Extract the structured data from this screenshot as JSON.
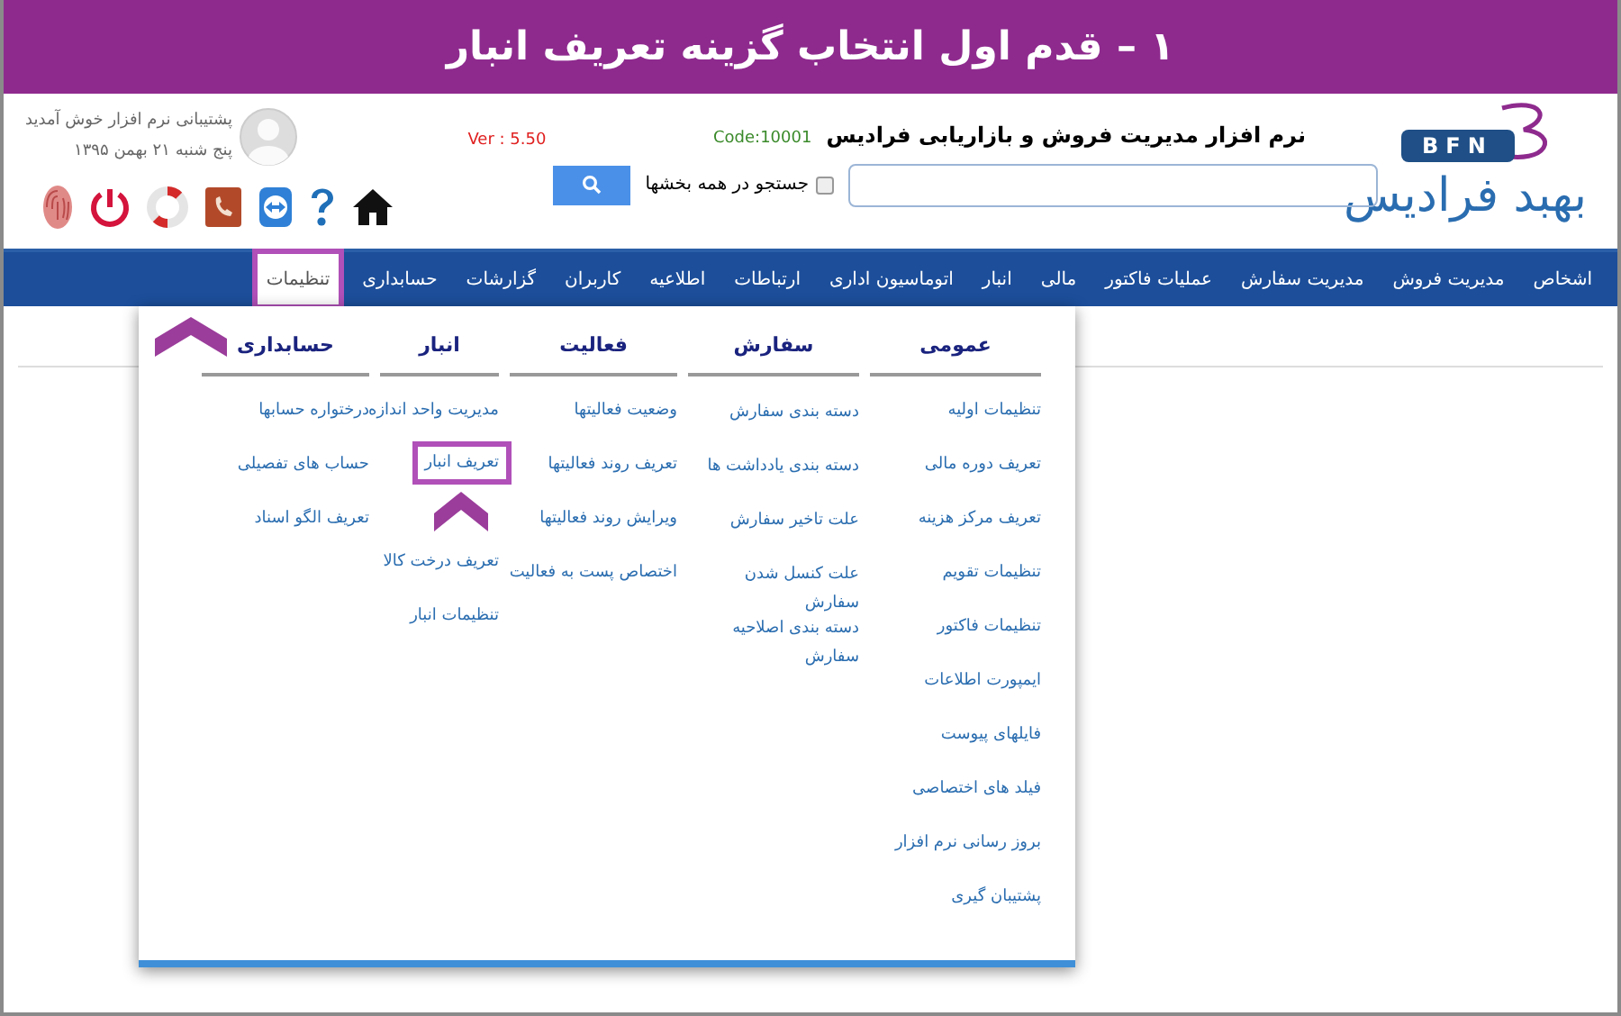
{
  "banner": {
    "title": "١ – قدم اول انتخاب گزینه تعریف انبار"
  },
  "header": {
    "logo_mark": "BFN",
    "logo_name": "بهبد فرادیس",
    "app_title": "نرم افزار مدیریت فروش و بازاریابی فرادیس",
    "code": "Code:10001",
    "version": "Ver : 5.50",
    "search_all": {
      "label": "جستجو در همه بخشها",
      "checked": false
    },
    "user": {
      "greeting": "پشتیبانی نرم افزار خوش آمدید",
      "date": "پنج شنبه ۲۱ بهمن ۱۳۹۵"
    }
  },
  "nav": [
    {
      "label": "اشخاص",
      "selected": false
    },
    {
      "label": "مدیریت فروش",
      "selected": false
    },
    {
      "label": "مدیریت سفارش",
      "selected": false
    },
    {
      "label": "عملیات فاکتور",
      "selected": false
    },
    {
      "label": "مالی",
      "selected": false
    },
    {
      "label": "انبار",
      "selected": false
    },
    {
      "label": "اتوماسیون اداری",
      "selected": false
    },
    {
      "label": "ارتباطات",
      "selected": false
    },
    {
      "label": "اطلاعیه",
      "selected": false
    },
    {
      "label": "کاربران",
      "selected": false
    },
    {
      "label": "گزارشات",
      "selected": false
    },
    {
      "label": "حسابداری",
      "selected": false
    },
    {
      "label": "تنظیمات",
      "selected": true
    }
  ],
  "menu": [
    {
      "title": "عمومی",
      "items": [
        {
          "label": "تنظیمات اولیه",
          "highlighted": false
        },
        {
          "label": "تعریف دوره مالی",
          "highlighted": false
        },
        {
          "label": "تعریف مرکز هزینه",
          "highlighted": false
        },
        {
          "label": "تنظیمات تقویم",
          "highlighted": false
        },
        {
          "label": "تنظیمات فاکتور",
          "highlighted": false
        },
        {
          "label": "ایمپورت اطلاعات",
          "highlighted": false
        },
        {
          "label": "فایلهای پیوست",
          "highlighted": false
        },
        {
          "label": "فیلد های اختصاصی",
          "highlighted": false
        },
        {
          "label": "بروز رسانی نرم افزار",
          "highlighted": false
        },
        {
          "label": "پشتیبان گیری",
          "highlighted": false
        }
      ]
    },
    {
      "title": "سفارش",
      "items": [
        {
          "label": "دسته بندی سفارش",
          "highlighted": false
        },
        {
          "label": "دسته بندی یادداشت ها",
          "highlighted": false
        },
        {
          "label": "علت تاخیر سفارش",
          "highlighted": false
        },
        {
          "label": "علت کنسل شدن سفارش",
          "highlighted": false
        },
        {
          "label": "دسته بندی اصلاحیه سفارش",
          "highlighted": false
        }
      ]
    },
    {
      "title": "فعالیت",
      "items": [
        {
          "label": "وضعیت فعالیتها",
          "highlighted": false
        },
        {
          "label": "تعریف روند فعالیتها",
          "highlighted": false
        },
        {
          "label": "ویرایش روند فعالیتها",
          "highlighted": false
        },
        {
          "label": "اختصاص پست به فعالیت",
          "highlighted": false
        }
      ]
    },
    {
      "title": "انبار",
      "items": [
        {
          "label": "مدیریت واحد اندازه",
          "highlighted": false
        },
        {
          "label": "تعریف انبار",
          "highlighted": true
        },
        {
          "label": "تعریف درخت کالا",
          "highlighted": false
        },
        {
          "label": "تنظیمات انبار",
          "highlighted": false
        }
      ]
    },
    {
      "title": "حسابداری",
      "items": [
        {
          "label": "درختواره حسابها",
          "highlighted": false
        },
        {
          "label": "حساب های تفصیلی",
          "highlighted": false
        },
        {
          "label": "تعریف الگو اسناد",
          "highlighted": false
        }
      ]
    }
  ]
}
